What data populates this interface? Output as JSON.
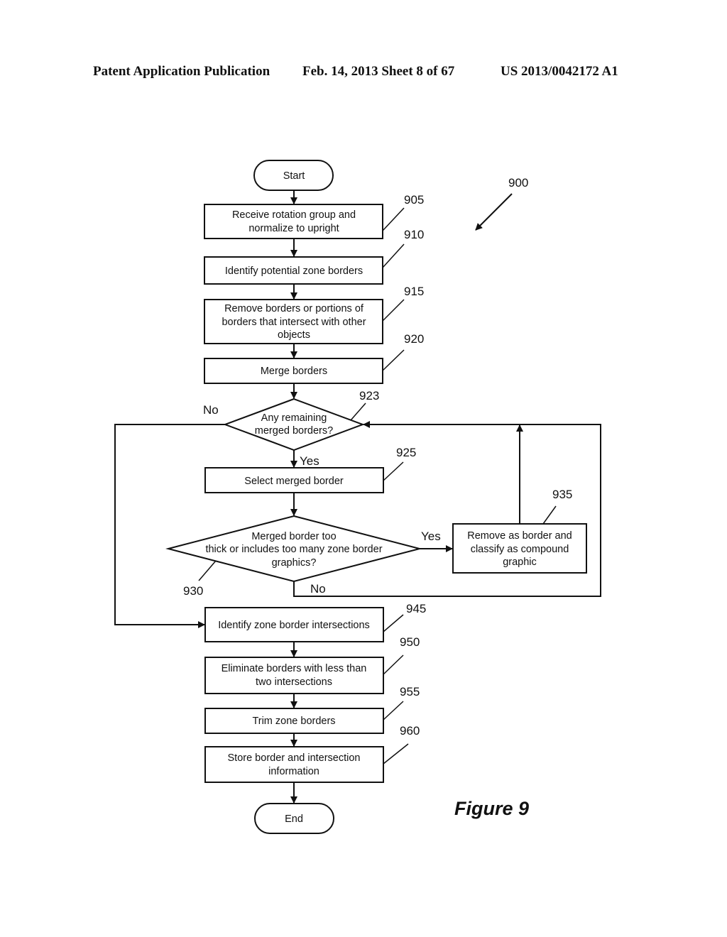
{
  "header": {
    "publication": "Patent Application Publication",
    "date_sheet": "Feb. 14, 2013   Sheet 8 of 67",
    "number": "US 2013/0042172 A1"
  },
  "diagram": {
    "figure_ref": "900",
    "figure_label": "Figure 9",
    "start": "Start",
    "end": "End",
    "nodes": [
      {
        "ref": "905",
        "lines": [
          "Receive rotation group and",
          "normalize to upright"
        ]
      },
      {
        "ref": "910",
        "lines": [
          "Identify potential zone borders"
        ]
      },
      {
        "ref": "915",
        "lines": [
          "Remove borders or portions of",
          "borders that intersect with other",
          "objects"
        ]
      },
      {
        "ref": "920",
        "lines": [
          "Merge borders"
        ]
      },
      {
        "ref": "923",
        "lines": [
          "Any remaining",
          "merged borders?"
        ]
      },
      {
        "ref": "925",
        "lines": [
          "Select merged border"
        ]
      },
      {
        "ref": "930",
        "lines": [
          "Merged border too",
          "thick or includes too many zone border",
          "graphics?"
        ]
      },
      {
        "ref": "935",
        "lines": [
          "Remove as border and",
          "classify as compound",
          "graphic"
        ]
      },
      {
        "ref": "945",
        "lines": [
          "Identify zone border intersections"
        ]
      },
      {
        "ref": "950",
        "lines": [
          "Eliminate borders with less than",
          "two intersections"
        ]
      },
      {
        "ref": "955",
        "lines": [
          "Trim zone borders"
        ]
      },
      {
        "ref": "960",
        "lines": [
          "Store border and intersection",
          "information"
        ]
      }
    ],
    "edge_labels": {
      "yes": "Yes",
      "no": "No"
    }
  }
}
